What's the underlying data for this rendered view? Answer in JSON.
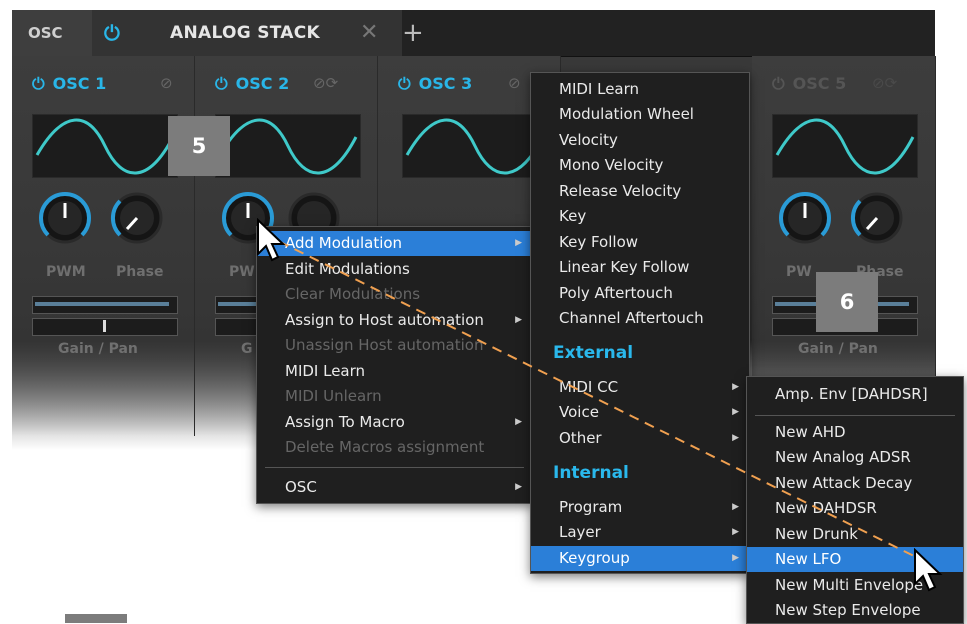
{
  "tabs": {
    "osc_label": "OSC",
    "stack_title": "ANALOG STACK",
    "close_glyph": "✕",
    "add_glyph": "+"
  },
  "oscillators": [
    {
      "name": "OSC 1",
      "knob1": "PWM",
      "knob2": "Phase",
      "gainpan": "Gain / Pan"
    },
    {
      "name": "OSC 2",
      "knob1": "PW",
      "knob2": "",
      "gainpan": "G"
    },
    {
      "name": "OSC 3",
      "knob1": "",
      "knob2": "",
      "gainpan": ""
    },
    {
      "name": "OSC 5",
      "knob1": "PW",
      "knob2": "Phase",
      "gainpan": "Gain / Pan"
    }
  ],
  "badges": {
    "five": "5",
    "six": "6"
  },
  "context_menu": {
    "items": [
      {
        "label": "Add Modulation",
        "state": "highlighted",
        "submenu": true
      },
      {
        "label": "Edit Modulations",
        "state": "enabled",
        "submenu": false
      },
      {
        "label": "Clear Modulations",
        "state": "disabled",
        "submenu": false
      },
      {
        "label": "Assign to Host automation",
        "state": "enabled",
        "submenu": true
      },
      {
        "label": "Unassign Host automation",
        "state": "disabled",
        "submenu": false
      },
      {
        "label": "MIDI Learn",
        "state": "enabled",
        "submenu": false
      },
      {
        "label": "MIDI Unlearn",
        "state": "disabled",
        "submenu": false
      },
      {
        "label": "Assign To Macro",
        "state": "enabled",
        "submenu": true
      },
      {
        "label": "Delete Macros assignment",
        "state": "disabled",
        "submenu": false
      },
      {
        "label": "OSC",
        "state": "enabled",
        "submenu": true
      }
    ]
  },
  "modulation_menu": {
    "top_items": [
      "MIDI Learn",
      "Modulation Wheel",
      "Velocity",
      "Mono Velocity",
      "Release Velocity",
      "Key",
      "Key Follow",
      "Linear Key Follow",
      "Poly Aftertouch",
      "Channel Aftertouch"
    ],
    "external_header": "External",
    "external_items": [
      "MIDI CC",
      "Voice",
      "Other"
    ],
    "internal_header": "Internal",
    "internal_items": [
      "Program",
      "Layer",
      "Keygroup"
    ]
  },
  "keygroup_menu": {
    "items": [
      "Amp. Env [DAHDSR]",
      "New AHD",
      "New Analog ADSR",
      "New Attack Decay",
      "New DAHDSR",
      "New Drunk",
      "New LFO",
      "New Multi Envelope",
      "New Step Envelope"
    ],
    "highlighted": "New LFO"
  },
  "colors": {
    "accent": "#29b6e8",
    "highlight": "#2b7fd8",
    "dashed_line": "#f0a050"
  }
}
